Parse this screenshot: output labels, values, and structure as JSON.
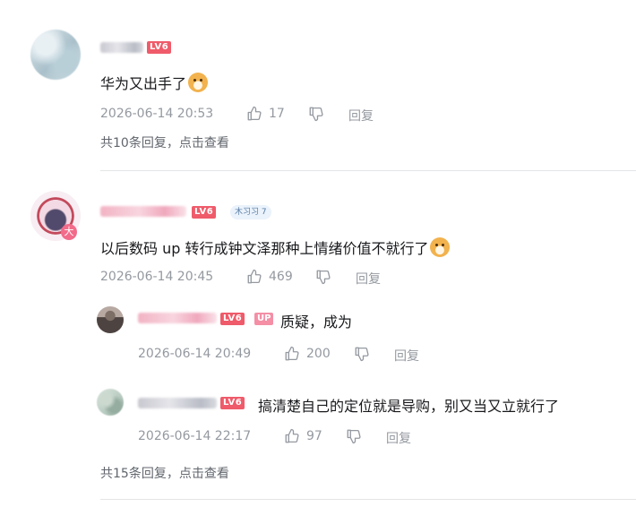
{
  "colors": {
    "level_badge": "#ef5b6a",
    "up_badge": "#f48fa6",
    "meta_text": "#9499a0",
    "content_text": "#18191c",
    "divider": "#e3e5e7"
  },
  "comments": [
    {
      "level": "LV6",
      "text": "华为又出手了",
      "emoji": "doge-emoji",
      "time": "2026-06-14 20:53",
      "likes": "17",
      "reply_label": "回复",
      "more": "共10条回复，点击查看"
    },
    {
      "level": "LV6",
      "fan_badge": "木习习 7",
      "avatar_badge": "大",
      "text": "以后数码 up 转行成钟文泽那种上情绪价值不就行了",
      "emoji": "doge-emoji",
      "time": "2026-06-14 20:45",
      "likes": "469",
      "reply_label": "回复",
      "replies": [
        {
          "level": "LV6",
          "up_tag": "UP",
          "text": "质疑，成为",
          "time": "2026-06-14 20:49",
          "likes": "200",
          "reply_label": "回复"
        },
        {
          "level": "LV6",
          "text": "搞清楚自己的定位就是导购，别又当又立就行了",
          "time": "2026-06-14 22:17",
          "likes": "97",
          "reply_label": "回复"
        }
      ],
      "more": "共15条回复，点击查看"
    }
  ],
  "icons": {
    "like": "thumbs-up-icon",
    "dislike": "thumbs-down-icon"
  }
}
